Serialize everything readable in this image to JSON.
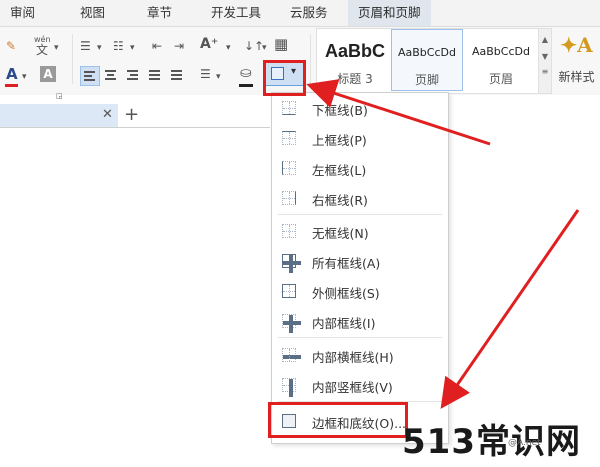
{
  "tabs": [
    {
      "label": "审阅"
    },
    {
      "label": "视图"
    },
    {
      "label": "章节"
    },
    {
      "label": "开发工具"
    },
    {
      "label": "云服务"
    },
    {
      "label": "页眉和页脚",
      "active": true
    }
  ],
  "ribbon": {
    "pinyin_top": "wén",
    "pinyin_char": "文",
    "font_color_letter": "A",
    "grow_font": "A⁺",
    "sort_glyph": "↓↑"
  },
  "styles_gallery": {
    "items": [
      {
        "sample": "AaBbC",
        "name": "标题 3"
      },
      {
        "sample": "AaBbCcDd",
        "name": "页脚",
        "selected": true
      },
      {
        "sample": "AaBbCcDd",
        "name": "页眉"
      }
    ],
    "new_style_label": "新样式"
  },
  "border_menu": {
    "items": [
      {
        "label": "下框线(B)",
        "icon": "bottom-border-icon"
      },
      {
        "label": "上框线(P)",
        "icon": "top-border-icon"
      },
      {
        "label": "左框线(L)",
        "icon": "left-border-icon"
      },
      {
        "label": "右框线(R)",
        "icon": "right-border-icon"
      },
      {
        "label": "无框线(N)",
        "icon": "no-border-icon"
      },
      {
        "label": "所有框线(A)",
        "icon": "all-borders-icon"
      },
      {
        "label": "外侧框线(S)",
        "icon": "outside-borders-icon"
      },
      {
        "label": "内部框线(I)",
        "icon": "inside-borders-icon"
      },
      {
        "label": "内部横框线(H)",
        "icon": "inside-horizontal-border-icon"
      },
      {
        "label": "内部竖框线(V)",
        "icon": "inside-vertical-border-icon"
      },
      {
        "label": "边框和底纹(O)...",
        "icon": "borders-and-shading-icon"
      }
    ]
  },
  "watermark": {
    "text": "513常识网",
    "sub": "@A.net"
  },
  "colors": {
    "annotation_red": "#e02020",
    "selection_blue": "#cfe0f4"
  }
}
